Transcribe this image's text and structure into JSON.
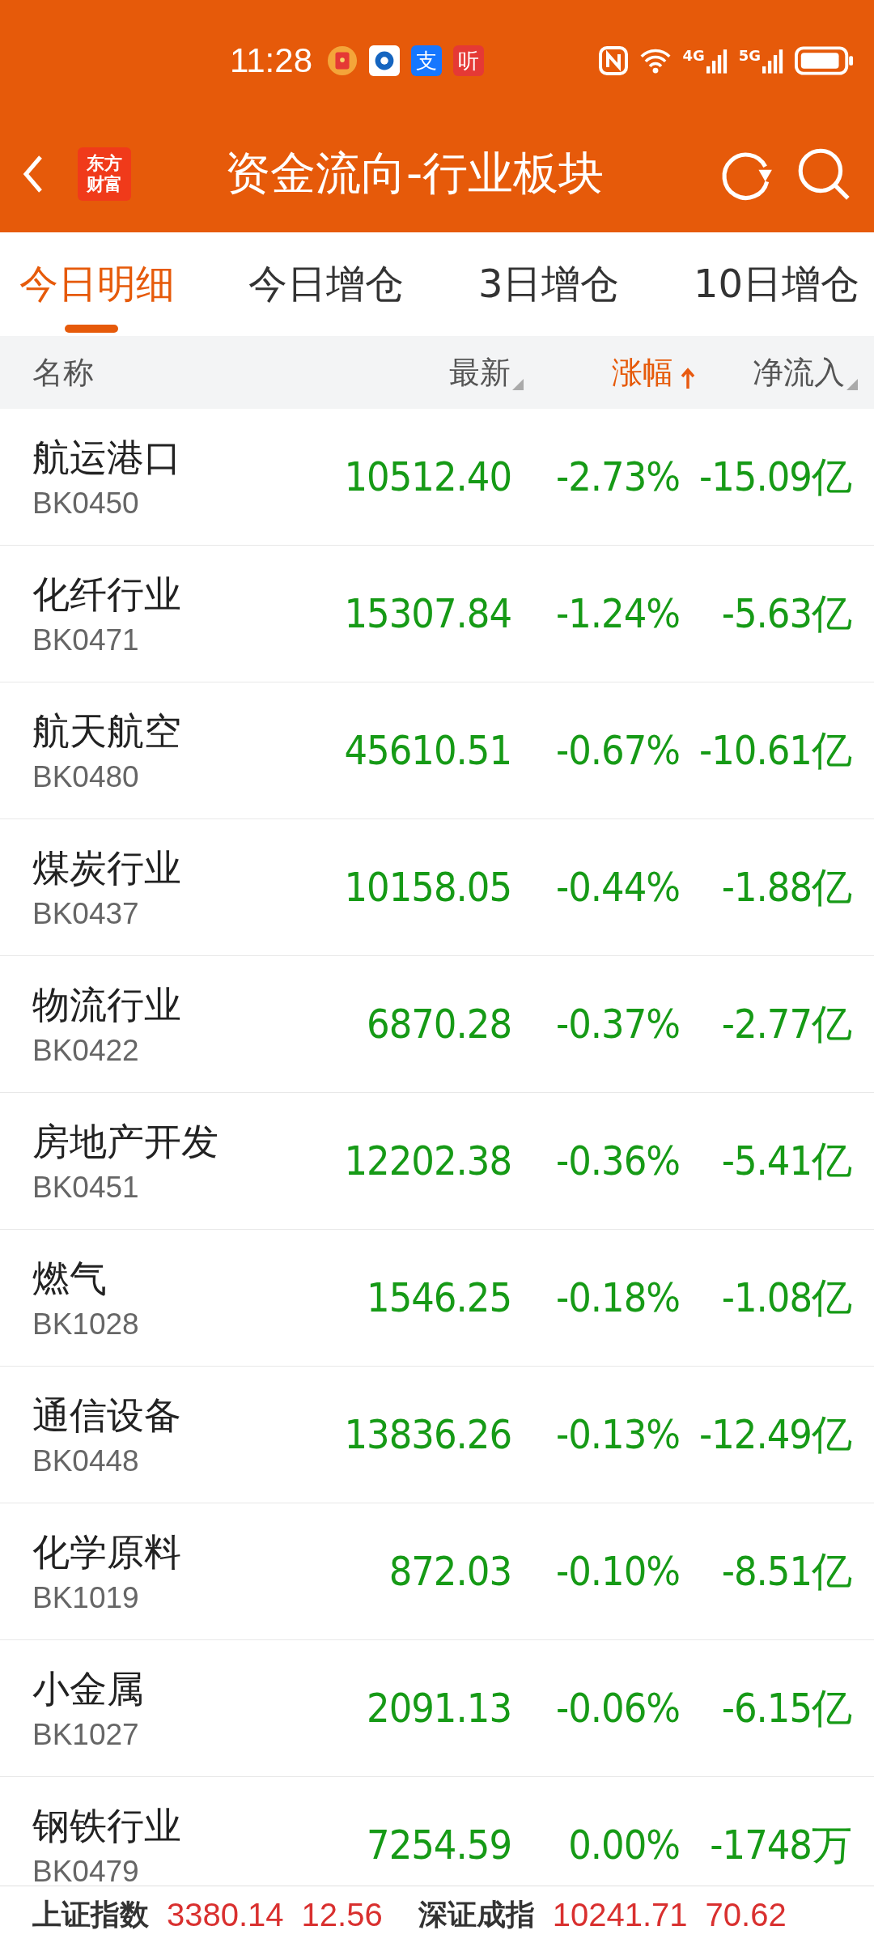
{
  "status_bar": {
    "time": "11:28",
    "notifications": [
      {
        "kind": "redpacket"
      },
      {
        "kind": "bank"
      },
      {
        "kind": "pay",
        "text": "支"
      },
      {
        "kind": "listen",
        "text": "听"
      }
    ],
    "network_1": "4G",
    "network_2": "5G"
  },
  "nav": {
    "logo_lines": [
      "东方",
      "财富"
    ],
    "title": "资金流向-行业板块"
  },
  "tabs": [
    {
      "label": "今日明细",
      "selected": true
    },
    {
      "label": "今日增仓",
      "selected": false
    },
    {
      "label": "3日增仓",
      "selected": false
    },
    {
      "label": "10日增仓",
      "selected": false
    }
  ],
  "columns": [
    {
      "label": "名称",
      "kind": "plain"
    },
    {
      "label": "最新",
      "kind": "sortable",
      "selected": false
    },
    {
      "label": "涨幅",
      "kind": "ascending",
      "selected": true
    },
    {
      "label": "净流入",
      "kind": "sortable",
      "selected": false
    }
  ],
  "rows": [
    {
      "name": "航运港口",
      "code": "BK0450",
      "price": "10512.40",
      "change": "-2.73%",
      "flow": "-15.09亿"
    },
    {
      "name": "化纤行业",
      "code": "BK0471",
      "price": "15307.84",
      "change": "-1.24%",
      "flow": "-5.63亿"
    },
    {
      "name": "航天航空",
      "code": "BK0480",
      "price": "45610.51",
      "change": "-0.67%",
      "flow": "-10.61亿"
    },
    {
      "name": "煤炭行业",
      "code": "BK0437",
      "price": "10158.05",
      "change": "-0.44%",
      "flow": "-1.88亿"
    },
    {
      "name": "物流行业",
      "code": "BK0422",
      "price": "6870.28",
      "change": "-0.37%",
      "flow": "-2.77亿"
    },
    {
      "name": "房地产开发",
      "code": "BK0451",
      "price": "12202.38",
      "change": "-0.36%",
      "flow": "-5.41亿"
    },
    {
      "name": "燃气",
      "code": "BK1028",
      "price": "1546.25",
      "change": "-0.18%",
      "flow": "-1.08亿"
    },
    {
      "name": "通信设备",
      "code": "BK0448",
      "price": "13836.26",
      "change": "-0.13%",
      "flow": "-12.49亿"
    },
    {
      "name": "化学原料",
      "code": "BK1019",
      "price": "872.03",
      "change": "-0.10%",
      "flow": "-8.51亿"
    },
    {
      "name": "小金属",
      "code": "BK1027",
      "price": "2091.13",
      "change": "-0.06%",
      "flow": "-6.15亿"
    },
    {
      "name": "钢铁行业",
      "code": "BK0479",
      "price": "7254.59",
      "change": "0.00%",
      "flow": "-1748万"
    }
  ],
  "index_bar": [
    {
      "name": "上证指数",
      "value": "3380.14",
      "change": "12.56"
    },
    {
      "name": "深证成指",
      "value": "10241.71",
      "change": "70.62"
    }
  ]
}
